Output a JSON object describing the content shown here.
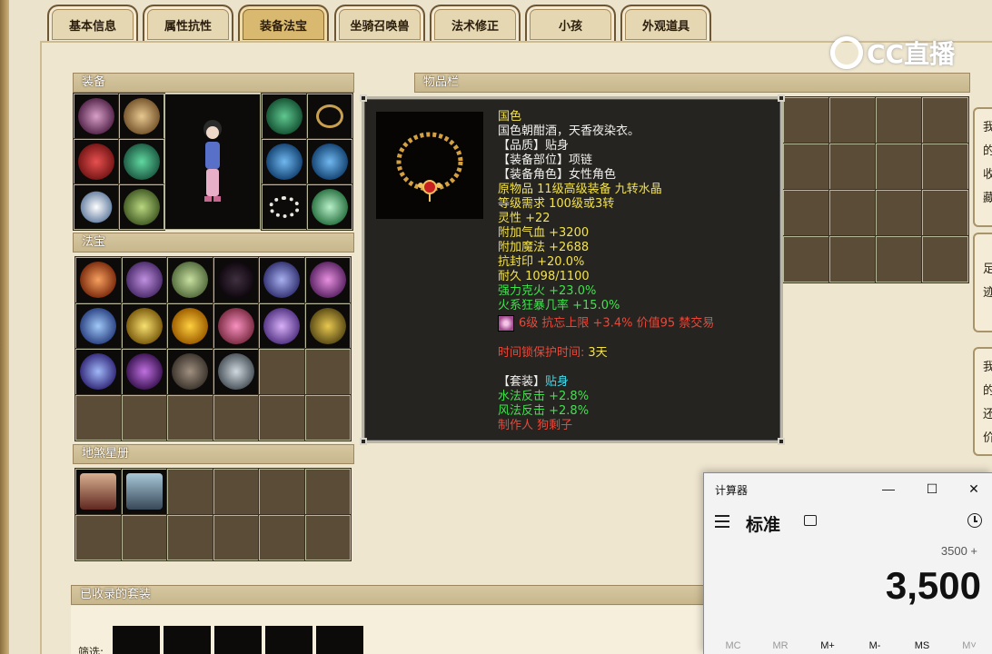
{
  "tabs": [
    "基本信息",
    "属性抗性",
    "装备法宝",
    "坐骑召唤兽",
    "法术修正",
    "小孩",
    "外观道具"
  ],
  "active_tab": "装备法宝",
  "sections": {
    "equip": "装备",
    "fabao": "法宝",
    "disha": "地煞星册",
    "inventory": "物品栏",
    "collected_sets": "已收录的套装",
    "filter_label": "筛选:"
  },
  "logo_text": "CC直播",
  "tooltip": {
    "name": "国色",
    "desc": "国色朝酣酒，天香夜染衣。",
    "quality": "【品质】贴身",
    "slot": "【装备部位】项链",
    "role": "【装备角色】女性角色",
    "origin": "原物品 11级高级装备 九转水晶",
    "level_req": "等级需求 100级或3转",
    "stat1": "灵性 +22",
    "stat2": "附加气血 +3200",
    "stat3": "附加魔法 +2688",
    "stat4": "抗封印 +20.0%",
    "durability": "耐久 1098/1100",
    "bonus1": "强力克火 +23.0%",
    "bonus2": "火系狂暴几率 +15.0%",
    "gem_line": "6级 抗忘上限 +3.4% 价值95 禁交易",
    "protect_label": "时间锁保护时间:",
    "protect_value": "3天",
    "set_label": "【套装】",
    "set_value": "贴身",
    "set1": "水法反击 +2.8%",
    "set2": "风法反击 +2.8%",
    "maker": "制作人 狗剩子"
  },
  "side_cards": [
    {
      "chars": [
        "我",
        "的",
        "收",
        "藏"
      ]
    },
    {
      "chars": [
        "足",
        "迹"
      ]
    },
    {
      "chars": [
        "我",
        "的",
        "还",
        "价"
      ]
    }
  ],
  "calculator": {
    "title": "计算器",
    "mode": "标准",
    "expression": "3500 +",
    "result": "3,500",
    "minimize": "—",
    "maximize": "☐",
    "close": "✕",
    "memory": [
      "MC",
      "MR",
      "M+",
      "M-",
      "MS",
      "M˅"
    ],
    "memory_enabled": [
      false,
      false,
      true,
      true,
      true,
      false
    ]
  },
  "colors": {
    "tooltip_bg": "#262420",
    "yellow": "#f3e24a",
    "green": "#3ee34c",
    "red": "#e8483a",
    "cyan": "#46d8e8"
  }
}
